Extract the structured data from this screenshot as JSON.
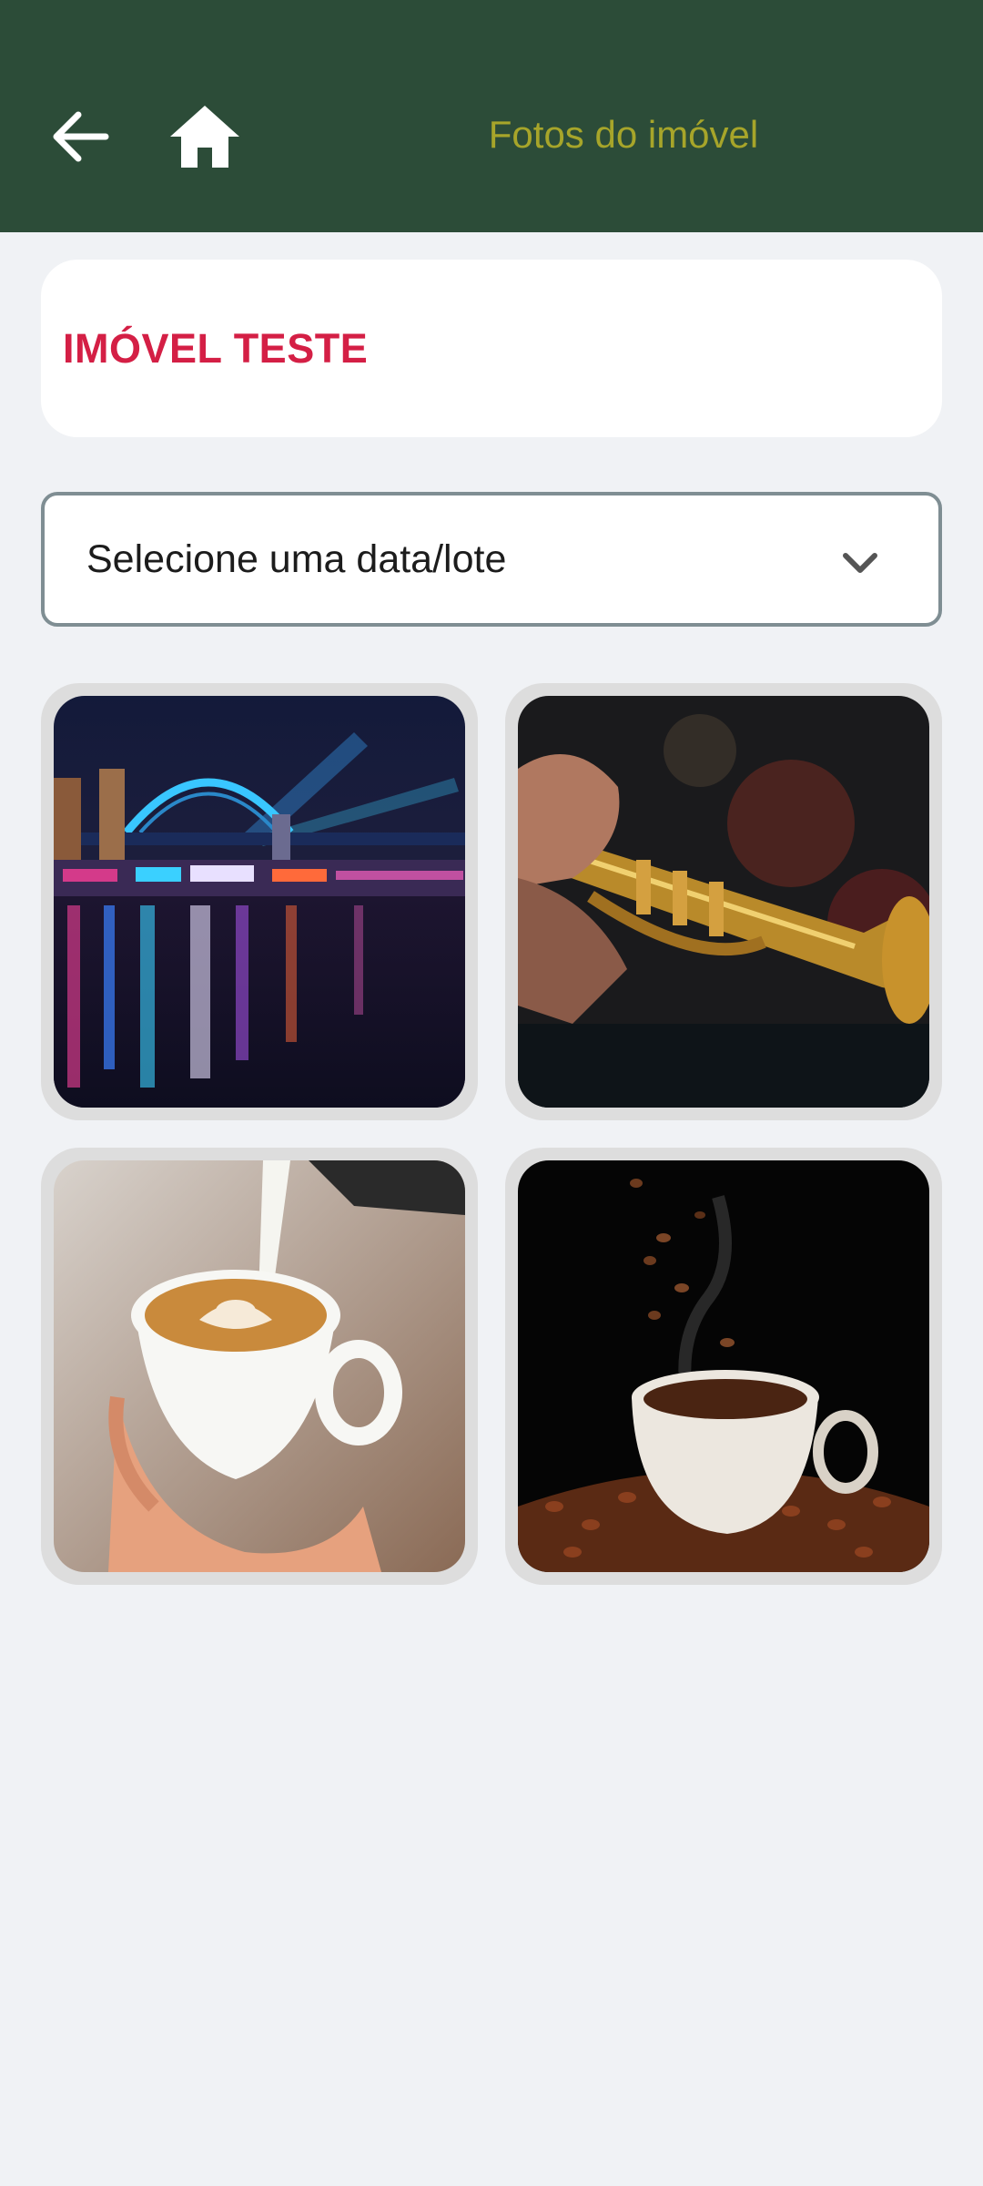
{
  "header": {
    "title": "Fotos do imóvel",
    "back_icon": "arrow-back-icon",
    "home_icon": "home-icon",
    "background_color": "#2c4c38",
    "title_color": "#a7a52a"
  },
  "property": {
    "name": "IMÓVEL TESTE",
    "name_color": "#d41f45"
  },
  "date_select": {
    "placeholder": "Selecione uma data/lote",
    "icon": "chevron-down-icon"
  },
  "photos": [
    {
      "subject": "bridge-night-photo"
    },
    {
      "subject": "trumpet-photo"
    },
    {
      "subject": "latte-art-photo"
    },
    {
      "subject": "coffee-beans-cup-photo"
    }
  ]
}
